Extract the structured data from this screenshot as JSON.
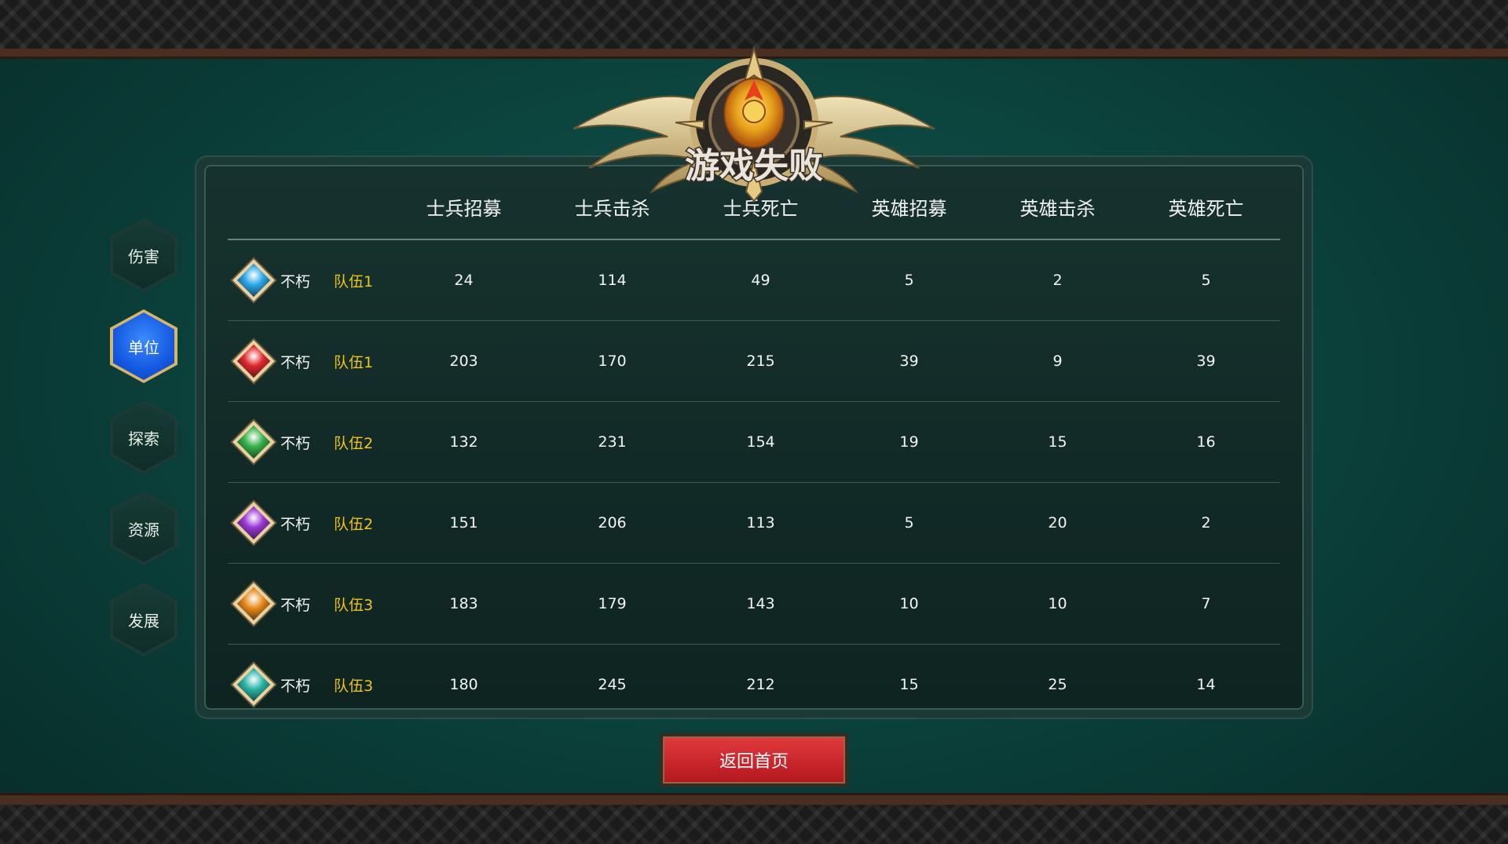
{
  "title": "游戏失败",
  "side_tabs": [
    {
      "label": "伤害",
      "active": false
    },
    {
      "label": "单位",
      "active": true
    },
    {
      "label": "探索",
      "active": false
    },
    {
      "label": "资源",
      "active": false
    },
    {
      "label": "发展",
      "active": false
    }
  ],
  "table": {
    "headers": [
      "士兵招募",
      "士兵击杀",
      "士兵死亡",
      "英雄招募",
      "英雄击杀",
      "英雄死亡"
    ],
    "rows": [
      {
        "color": "#2aa7e8",
        "name": "不朽",
        "team": "队伍1",
        "values": [
          "24",
          "114",
          "49",
          "5",
          "2",
          "5"
        ]
      },
      {
        "color": "#e0282e",
        "name": "不朽",
        "team": "队伍1",
        "values": [
          "203",
          "170",
          "215",
          "39",
          "9",
          "39"
        ]
      },
      {
        "color": "#35b24a",
        "name": "不朽",
        "team": "队伍2",
        "values": [
          "132",
          "231",
          "154",
          "19",
          "15",
          "16"
        ]
      },
      {
        "color": "#9b36d6",
        "name": "不朽",
        "team": "队伍2",
        "values": [
          "151",
          "206",
          "113",
          "5",
          "20",
          "2"
        ]
      },
      {
        "color": "#e8891a",
        "name": "不朽",
        "team": "队伍3",
        "values": [
          "183",
          "179",
          "143",
          "10",
          "10",
          "7"
        ]
      },
      {
        "color": "#2ab5a8",
        "name": "不朽",
        "team": "队伍3",
        "values": [
          "180",
          "245",
          "212",
          "15",
          "25",
          "14"
        ]
      }
    ]
  },
  "return_button": "返回首页",
  "colors": {
    "team": "#f0c419",
    "active_tab": "#1458e0",
    "button": "#c8232a"
  }
}
